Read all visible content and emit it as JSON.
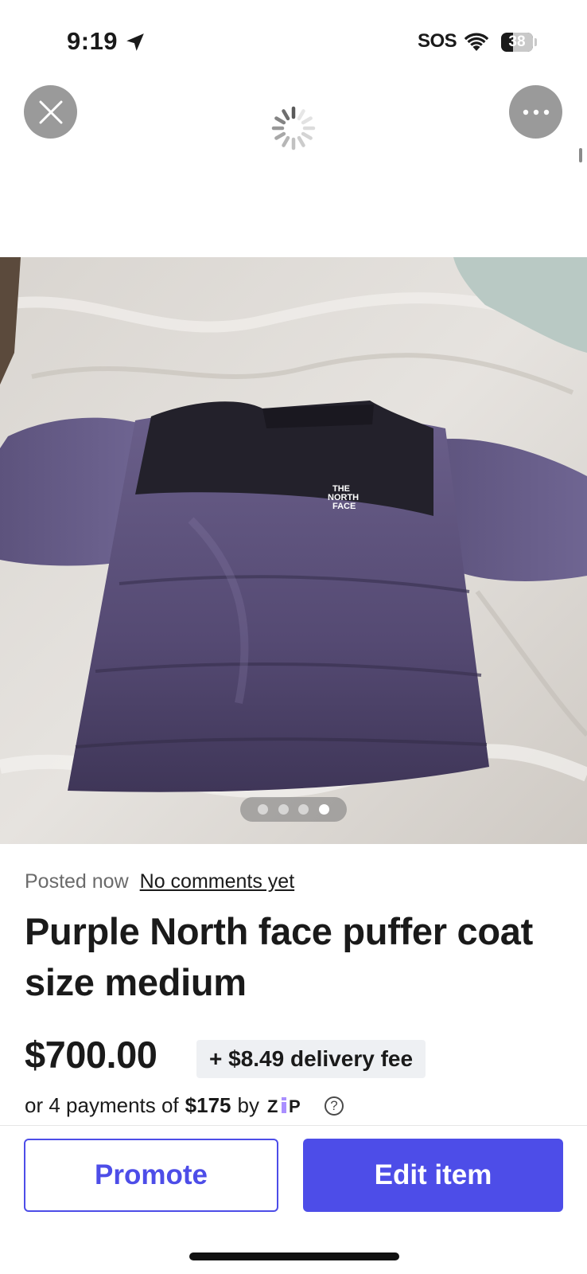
{
  "status_bar": {
    "time": "9:19",
    "carrier": "SOS",
    "battery_level": "38",
    "battery_fraction": 0.38
  },
  "header": {
    "close_icon": "close-icon",
    "more_icon": "more-horizontal-icon",
    "loading_icon": "loading-spinner-icon"
  },
  "photo": {
    "description_icon": "product-photo",
    "carousel_total": 4,
    "carousel_active": 4
  },
  "listing": {
    "posted": "Posted now",
    "comments_link": "No comments yet",
    "title": "Purple North face puffer coat size medium",
    "price": "$700.00",
    "delivery_fee": "+ $8.49 delivery fee",
    "installments_prefix": "or 4 payments of",
    "installments_amount": "$175",
    "installments_by": "by",
    "financing_brand": "zip"
  },
  "actions": {
    "promote_label": "Promote",
    "edit_label": "Edit item"
  },
  "colors": {
    "accent": "#4d4de8",
    "badge_bg": "#eef0f3",
    "overlay_button": "#9a9a9a"
  }
}
